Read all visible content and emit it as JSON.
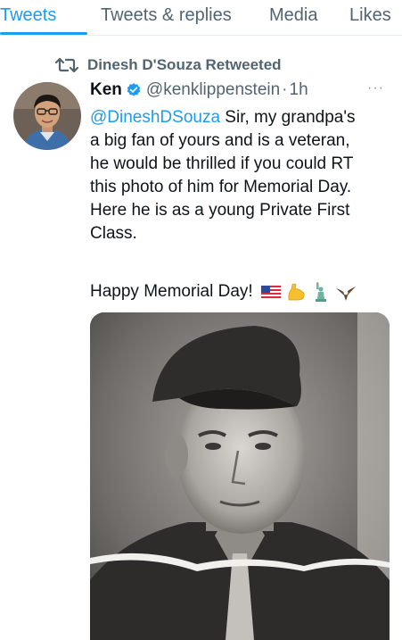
{
  "tabs": [
    {
      "label": "Tweets"
    },
    {
      "label": "Tweets & replies"
    },
    {
      "label": "Media"
    },
    {
      "label": "Likes"
    }
  ],
  "retweet": {
    "text": "Dinesh D'Souza Retweeted"
  },
  "tweet": {
    "author_name": "Ken",
    "handle": "@kenklippenstein",
    "separator": "·",
    "time": "1h",
    "more": "···",
    "mention": "@DineshDSouza",
    "lines": [
      " Sir, my grandpa's",
      "a big fan of yours and is a veteran,",
      "he would be thrilled if you could RT",
      "this photo of him for Memorial Day.",
      "Here he is as a young Private First",
      "Class."
    ],
    "closing": "Happy Memorial Day!",
    "emojis": [
      "us-flag-icon",
      "flexed-biceps-icon",
      "statue-of-liberty-icon",
      "eagle-icon"
    ]
  },
  "colors": {
    "accent": "#1d9bf0",
    "secondary_text": "#536471",
    "primary_text": "#0f1419"
  }
}
